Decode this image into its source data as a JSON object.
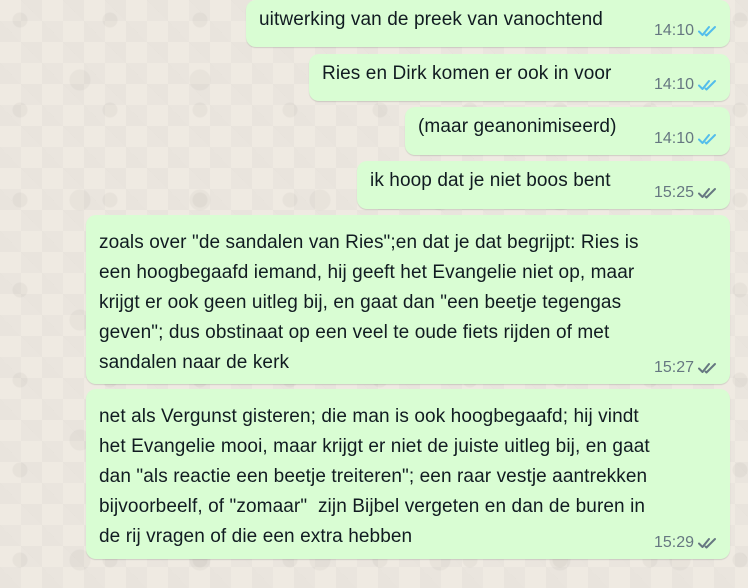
{
  "chat": {
    "messages": [
      {
        "text": "uitwerking van de preek van vanochtend",
        "time": "14:10",
        "status": "read",
        "tick_color": "#53bdeb"
      },
      {
        "text": "Ries en Dirk komen er ook in voor",
        "time": "14:10",
        "status": "read",
        "tick_color": "#53bdeb"
      },
      {
        "text": "(maar geanonimiseerd)",
        "time": "14:10",
        "status": "read",
        "tick_color": "#53bdeb"
      },
      {
        "text": "ik hoop dat je niet boos bent",
        "time": "15:25",
        "status": "delivered",
        "tick_color": "#667781"
      },
      {
        "text": "zoals over \"de sandalen van Ries\";en dat je dat begrijpt: Ries is\neen hoogbegaafd iemand, hij geeft het Evangelie niet op, maar\nkrijgt er ook geen uitleg bij, en gaat dan \"een beetje tegengas\ngeven\"; dus obstinaat op een veel te oude fiets rijden of met\nsandalen naar de kerk",
        "time": "15:27",
        "status": "delivered",
        "tick_color": "#667781"
      },
      {
        "text": "net als Vergunst gisteren; die man is ook hoogbegaafd; hij vindt\nhet Evangelie mooi, maar krijgt er niet de juiste uitleg bij, en gaat\ndan \"als reactie een beetje treiteren\"; een raar vestje aantrekken\nbijvoorbeelf, of \"zomaar\"  zijn Bijbel vergeten en dan de buren in\nde rij vragen of die een extra hebben",
        "time": "15:29",
        "status": "delivered",
        "tick_color": "#667781"
      }
    ]
  },
  "colors": {
    "bubble_outgoing": "#d9fdd3",
    "wallpaper": "#efeae2",
    "text": "#111b21",
    "meta_text": "#667781",
    "read_tick": "#53bdeb"
  },
  "icons": {
    "read_status": "double-check-icon",
    "delivered_status": "double-check-icon"
  }
}
